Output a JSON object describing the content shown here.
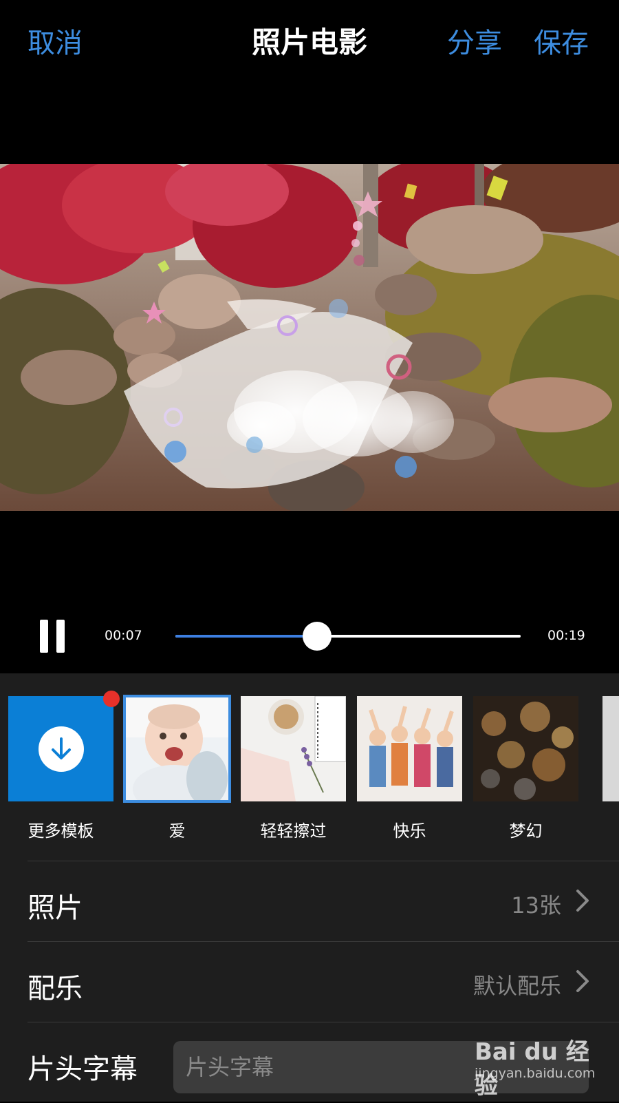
{
  "header": {
    "cancel_label": "取消",
    "title": "照片电影",
    "share_label": "分享",
    "save_label": "保存",
    "accent_color": "#3d8de0"
  },
  "player": {
    "state": "playing",
    "current_time": "00:07",
    "total_time": "00:19",
    "progress": 0.41
  },
  "templates": [
    {
      "label": "更多模板",
      "icon": "download-icon",
      "badge": "red-dot"
    },
    {
      "label": "爱",
      "selected": true
    },
    {
      "label": "轻轻擦过"
    },
    {
      "label": "快乐"
    },
    {
      "label": "梦幻"
    }
  ],
  "settings": {
    "photos_label": "照片",
    "photos_value": "13张",
    "music_label": "配乐",
    "music_value": "默认配乐",
    "caption_label": "片头字幕",
    "caption_placeholder": "片头字幕"
  },
  "watermark": {
    "brand": "Bai du 经验",
    "url": "jingyan.baidu.com"
  }
}
